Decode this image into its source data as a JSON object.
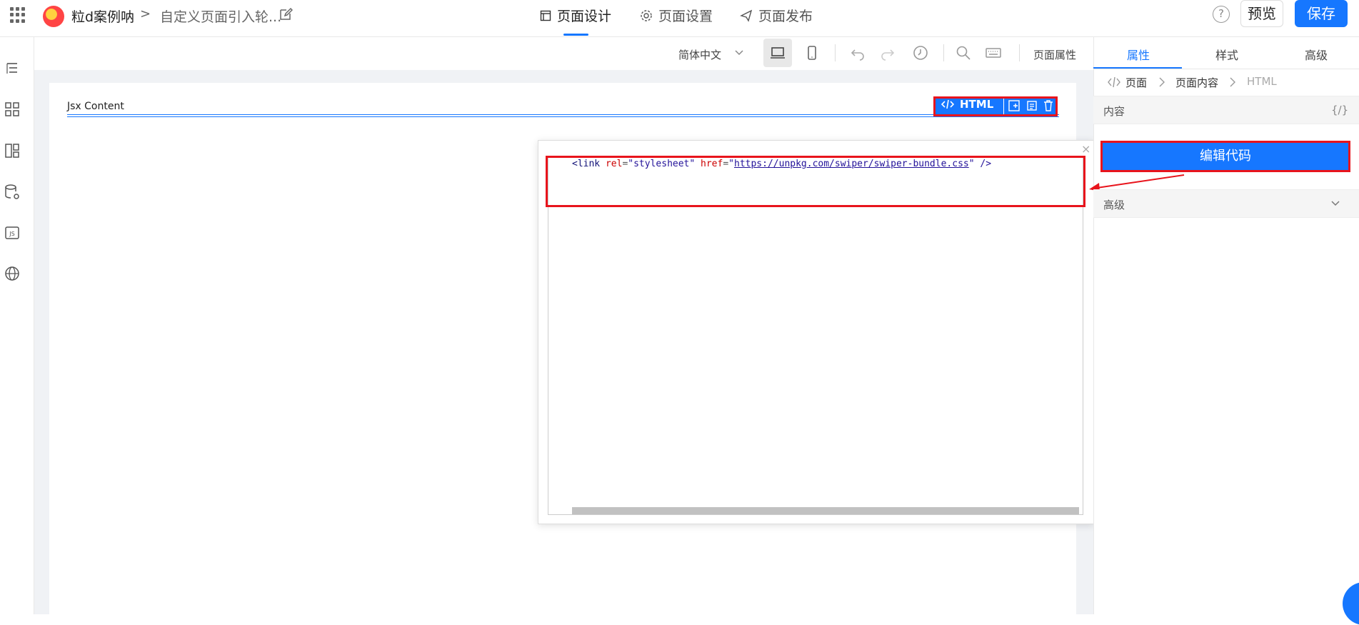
{
  "header": {
    "app_name": "粒d案例呐",
    "breadcrumb_sep": ">",
    "page_name": "自定义页面引入轮...",
    "tabs": [
      {
        "label": "页面设计",
        "icon": "layout-icon"
      },
      {
        "label": "页面设置",
        "icon": "gear-icon"
      },
      {
        "label": "页面发布",
        "icon": "send-icon"
      }
    ],
    "help_label": "?",
    "preview_label": "预览",
    "save_label": "保存"
  },
  "toolbar": {
    "language": "简体中文",
    "page_props_label": "页面属性"
  },
  "canvas": {
    "jsx_label": "Jsx Content",
    "component_label": "HTML"
  },
  "editor": {
    "code_open": "<",
    "code_tag": "link",
    "code_attr1": "rel",
    "code_eq": "=",
    "code_val1": "\"stylesheet\"",
    "code_attr2": "href",
    "code_val2_q": "\"",
    "code_url": "https://unpkg.com/swiper/swiper-bundle.css",
    "code_end": "\" />",
    "close_label": "×"
  },
  "right_panel": {
    "tabs": [
      "属性",
      "样式",
      "高级"
    ],
    "breadcrumb": [
      "页面",
      "页面内容",
      "HTML"
    ],
    "content_section": "内容",
    "content_brace": "{/}",
    "edit_code_label": "编辑代码",
    "advanced_section": "高级"
  },
  "colors": {
    "accent": "#1677ff",
    "highlight": "#e8141c"
  }
}
